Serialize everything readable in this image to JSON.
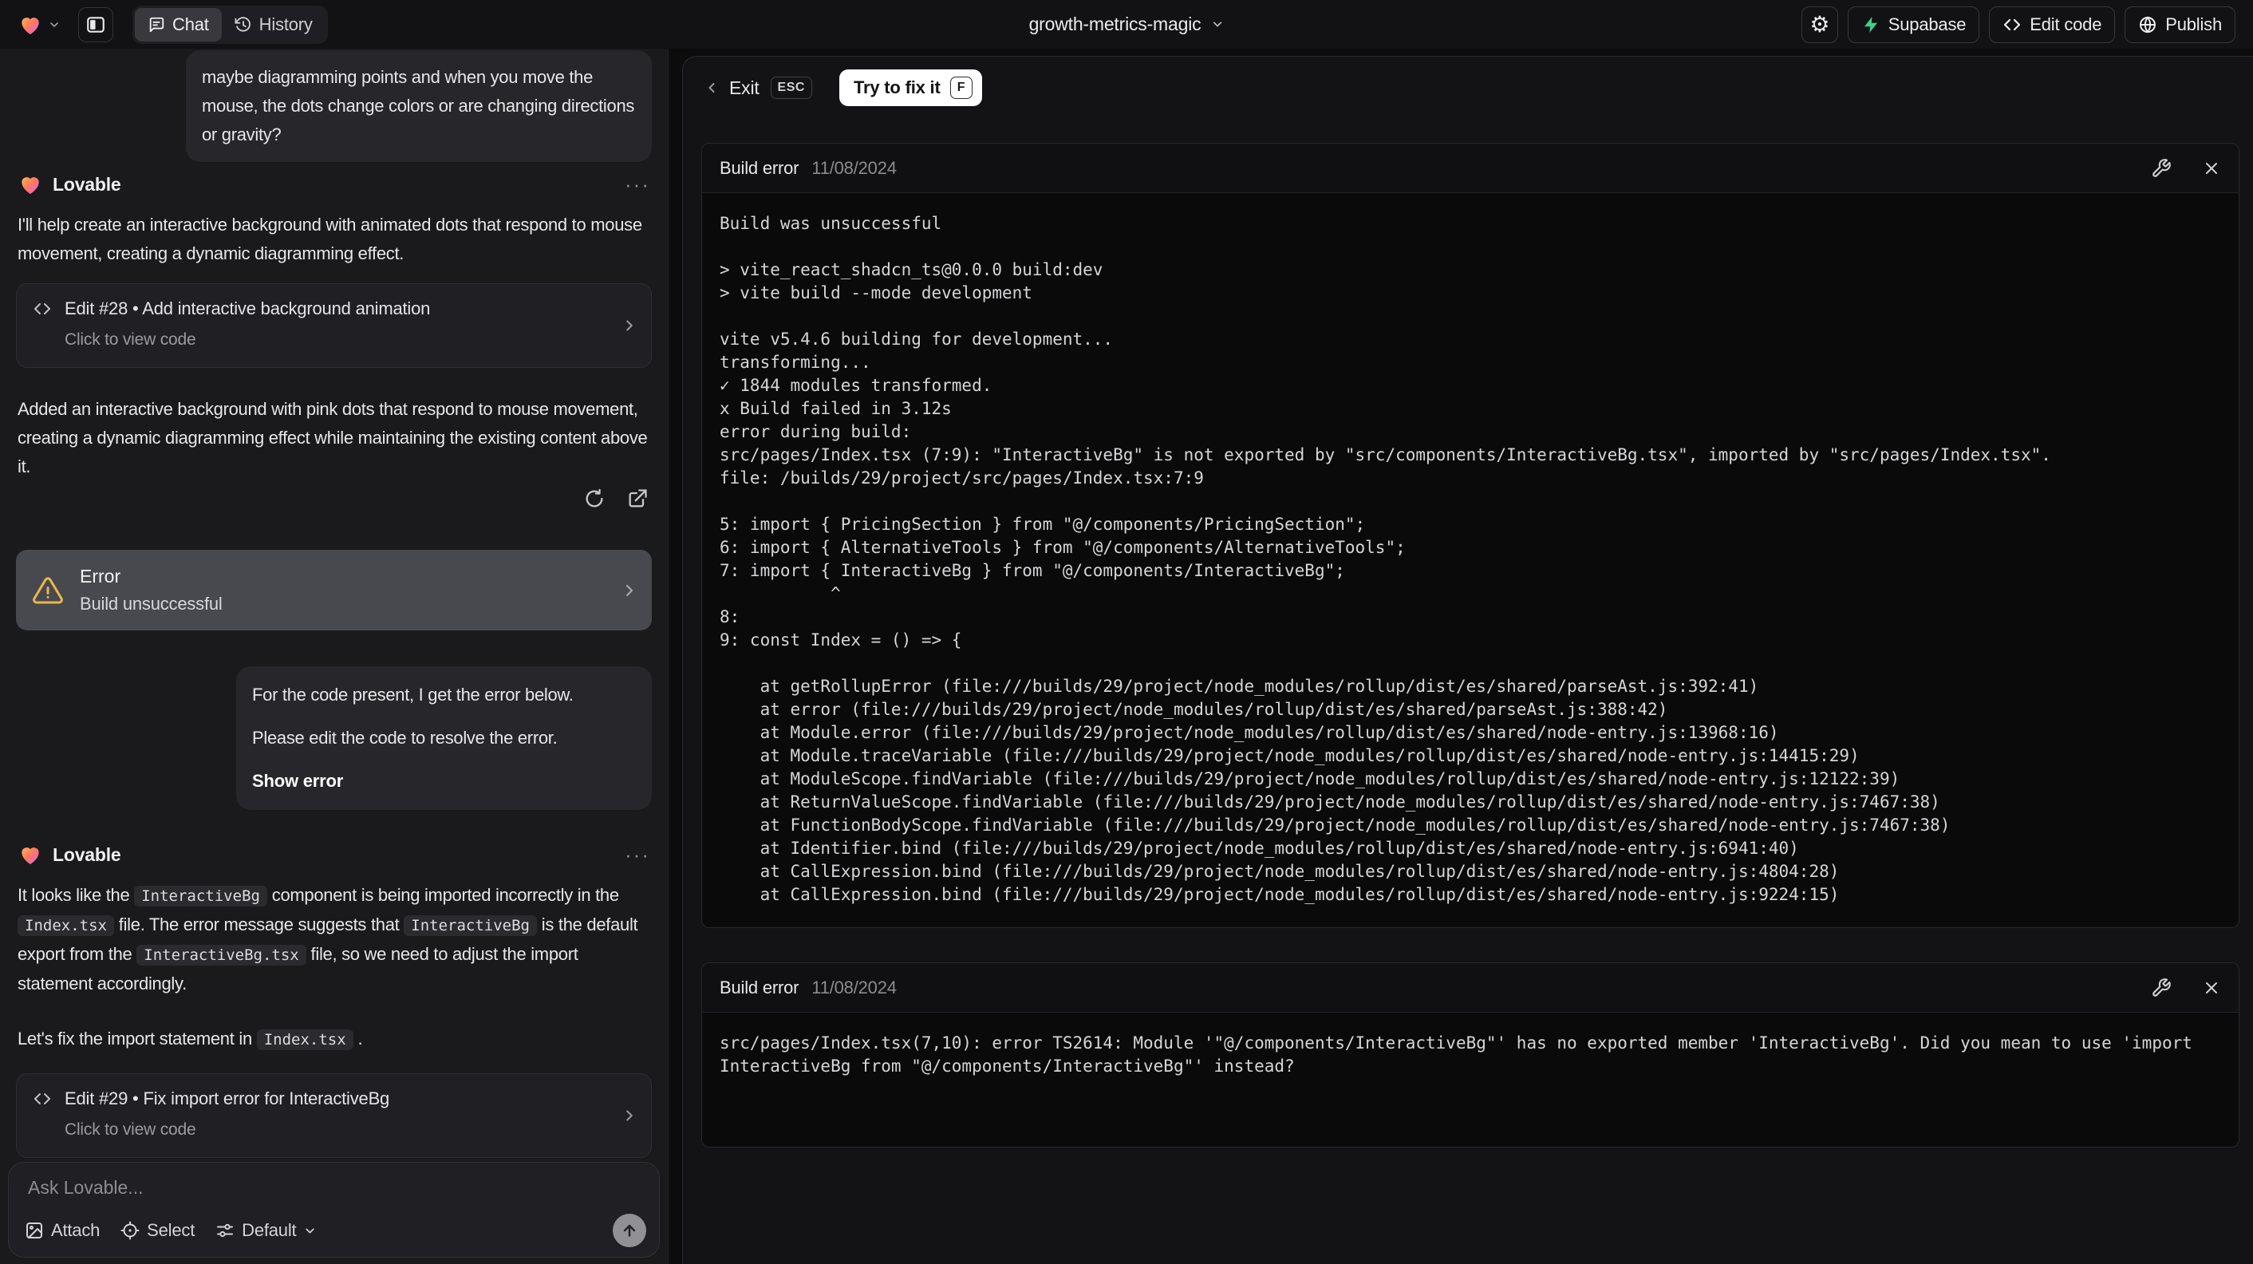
{
  "header": {
    "project_name": "growth-metrics-magic",
    "tab_chat": "Chat",
    "tab_history": "History",
    "supabase_label": "Supabase",
    "edit_code_label": "Edit code",
    "publish_label": "Publish"
  },
  "chat": {
    "assistant_name": "Lovable",
    "user_message_1": "maybe diagramming points and when you move the mouse, the dots change colors or are changing directions or gravity?",
    "assistant_message_1": {
      "p1": "I'll help create an interactive background with animated dots that respond to mouse movement, creating a dynamic diagramming effect.",
      "edit_card_label": "Edit #28 • Add interactive background animation",
      "edit_card_sub": "Click to view code",
      "p2": "Added an interactive background with pink dots that respond to mouse movement, creating a dynamic diagramming effect while maintaining the existing content above it."
    },
    "error_card": {
      "title": "Error",
      "subtitle": "Build unsuccessful"
    },
    "user_message_2": {
      "p1": "For the code present, I get the error below.",
      "p2": "Please edit the code to resolve the error.",
      "action": "Show error"
    },
    "assistant_message_2": {
      "p1": [
        {
          "t": "It looks like the "
        },
        {
          "t": "InteractiveBg"
        },
        {
          "t": " component is being imported incorrectly in the "
        },
        {
          "t": "Index.tsx"
        },
        {
          "t": " file. The error message suggests that "
        },
        {
          "t": "InteractiveBg"
        },
        {
          "t": " is the default export from the "
        },
        {
          "t": "InteractiveBg.tsx"
        },
        {
          "t": " file, so we need to adjust the import statement accordingly."
        }
      ],
      "p2": [
        {
          "t": "Let's fix the import statement in "
        },
        {
          "t": "Index.tsx"
        },
        {
          "t": " ."
        }
      ],
      "edit_card_label": "Edit #29 • Fix import error for InteractiveBg",
      "edit_card_sub": "Click to view code"
    },
    "input": {
      "placeholder": "Ask Lovable...",
      "attach_label": "Attach",
      "select_label": "Select",
      "mode_label": "Default"
    }
  },
  "error_view": {
    "exit_label": "Exit",
    "esc_key": "ESC",
    "fix_button_label": "Try to fix it",
    "fix_key": "F",
    "panel_1": {
      "title": "Build error",
      "date": "11/08/2024",
      "log": [
        "Build was unsuccessful",
        "",
        "> vite_react_shadcn_ts@0.0.0 build:dev",
        "> vite build --mode development",
        "",
        "vite v5.4.6 building for development...",
        "transforming...",
        "✓ 1844 modules transformed.",
        "x Build failed in 3.12s",
        "error during build:",
        "src/pages/Index.tsx (7:9): \"InteractiveBg\" is not exported by \"src/components/InteractiveBg.tsx\", imported by \"src/pages/Index.tsx\".",
        "file: /builds/29/project/src/pages/Index.tsx:7:9",
        "",
        "5: import { PricingSection } from \"@/components/PricingSection\";",
        "6: import { AlternativeTools } from \"@/components/AlternativeTools\";",
        "7: import { InteractiveBg } from \"@/components/InteractiveBg\";",
        "           ^",
        "8: ",
        "9: const Index = () => {",
        "",
        "    at getRollupError (file:///builds/29/project/node_modules/rollup/dist/es/shared/parseAst.js:392:41)",
        "    at error (file:///builds/29/project/node_modules/rollup/dist/es/shared/parseAst.js:388:42)",
        "    at Module.error (file:///builds/29/project/node_modules/rollup/dist/es/shared/node-entry.js:13968:16)",
        "    at Module.traceVariable (file:///builds/29/project/node_modules/rollup/dist/es/shared/node-entry.js:14415:29)",
        "    at ModuleScope.findVariable (file:///builds/29/project/node_modules/rollup/dist/es/shared/node-entry.js:12122:39)",
        "    at ReturnValueScope.findVariable (file:///builds/29/project/node_modules/rollup/dist/es/shared/node-entry.js:7467:38)",
        "    at FunctionBodyScope.findVariable (file:///builds/29/project/node_modules/rollup/dist/es/shared/node-entry.js:7467:38)",
        "    at Identifier.bind (file:///builds/29/project/node_modules/rollup/dist/es/shared/node-entry.js:6941:40)",
        "    at CallExpression.bind (file:///builds/29/project/node_modules/rollup/dist/es/shared/node-entry.js:4804:28)",
        "    at CallExpression.bind (file:///builds/29/project/node_modules/rollup/dist/es/shared/node-entry.js:9224:15)"
      ]
    },
    "panel_2": {
      "title": "Build error",
      "date": "11/08/2024",
      "log": "src/pages/Index.tsx(7,10): error TS2614: Module '\"@/components/InteractiveBg\"' has no exported member 'InteractiveBg'. Did you mean to use 'import InteractiveBg from \"@/components/InteractiveBg\"' instead?"
    }
  },
  "colors": {
    "accent_supabase": "#3ecf8e",
    "warning": "#e8b64c",
    "sidebar_bg": "#1a1a1d",
    "error_card_bg": "#47494f"
  }
}
